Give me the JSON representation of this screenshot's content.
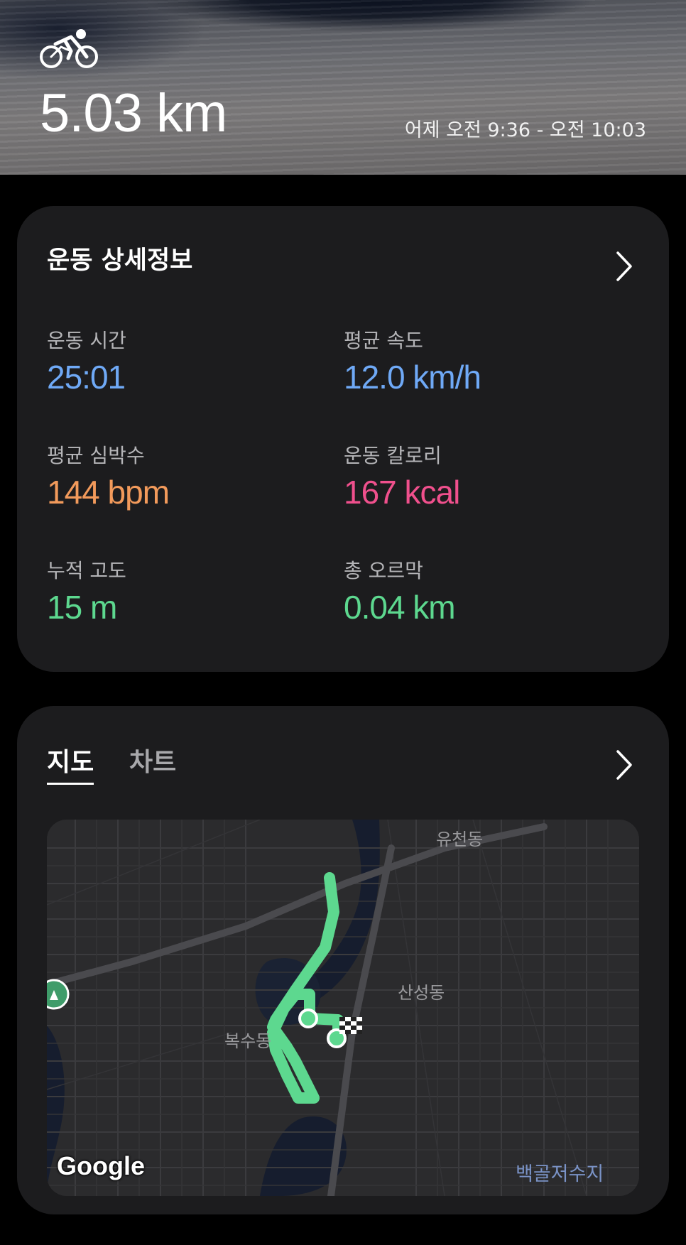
{
  "header": {
    "distance": "5.03 km",
    "time_range": "어제 오전 9:36 - 오전 10:03",
    "activity_icon": "bicycle-icon"
  },
  "details": {
    "title": "운동 상세정보",
    "stats": [
      {
        "label": "운동 시간",
        "value": "25:01",
        "color": "#6fa9f6"
      },
      {
        "label": "평균 속도",
        "value": "12.0 km/h",
        "color": "#6fa9f6"
      },
      {
        "label": "평균 심박수",
        "value": "144 bpm",
        "color": "#f29a5b"
      },
      {
        "label": "운동 칼로리",
        "value": "167 kcal",
        "color": "#f0508d"
      },
      {
        "label": "누적 고도",
        "value": "15 m",
        "color": "#5dd88f"
      },
      {
        "label": "총 오르막",
        "value": "0.04 km",
        "color": "#5dd88f"
      }
    ]
  },
  "map_card": {
    "tabs": [
      {
        "label": "지도",
        "active": true
      },
      {
        "label": "차트",
        "active": false
      }
    ],
    "map": {
      "labels": {
        "top_right": "유천동",
        "middle_right": "산성동",
        "middle_left": "복수동",
        "water": "백골저수지"
      },
      "attribution": "Google",
      "route_color": "#5dd88f"
    }
  }
}
